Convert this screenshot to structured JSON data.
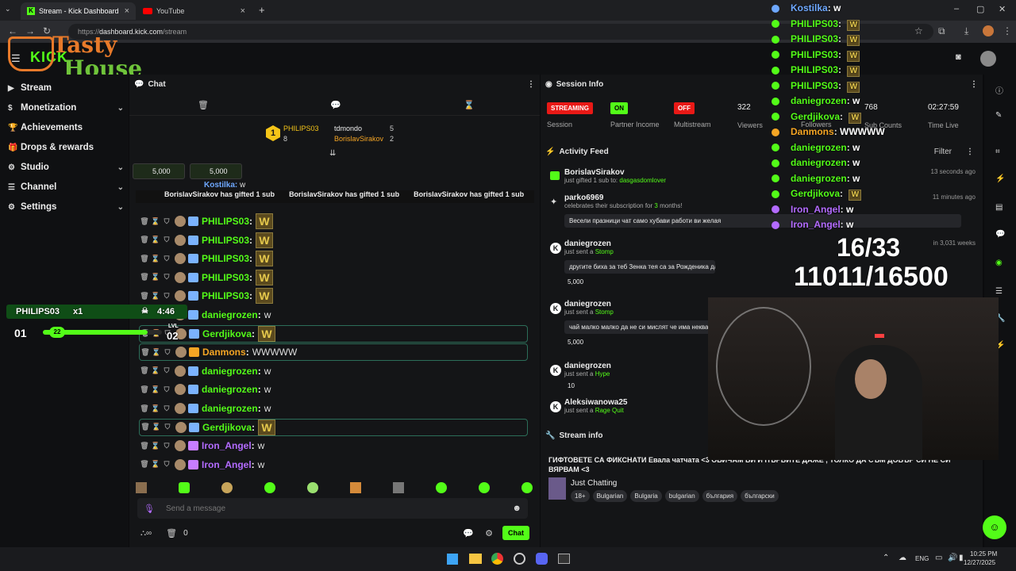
{
  "browser": {
    "tabs": [
      {
        "label": "Stream - Kick Dashboard"
      },
      {
        "label": "YouTube"
      }
    ],
    "url_prefix": "https://",
    "url_host": "dashboard.kick.com",
    "url_path": "/stream"
  },
  "overlay_logo": {
    "line1": "Tasty",
    "line2": "House"
  },
  "sidebar": {
    "items": [
      {
        "label": "Stream",
        "icon": "video-icon",
        "expandable": false
      },
      {
        "label": "Monetization",
        "icon": "dollar-icon",
        "expandable": true
      },
      {
        "label": "Achievements",
        "icon": "trophy-icon",
        "expandable": false
      },
      {
        "label": "Drops & rewards",
        "icon": "gift-icon",
        "expandable": false
      },
      {
        "label": "Studio",
        "icon": "gear-icon",
        "expandable": true
      },
      {
        "label": "Channel",
        "icon": "list-icon",
        "expandable": true
      },
      {
        "label": "Settings",
        "icon": "gear-icon",
        "expandable": true
      }
    ]
  },
  "chat": {
    "title": "Chat",
    "leaderboard": {
      "first": {
        "name": "PHILIPS03",
        "count": "8",
        "rank": "1"
      },
      "second": {
        "name": "tdmondo",
        "count": "5"
      },
      "third": {
        "name": "BorislavSirakov",
        "count": "2"
      }
    },
    "kick_chips": [
      "5,000",
      "5,000"
    ],
    "pinned_ticker": [
      "BorislavSirakov has gifted 1 sub",
      "BorislavSirakov has gifted 1 sub",
      "BorislavSirakov has gifted 1 sub"
    ],
    "top_partial_name": "Kostilka",
    "top_partial_text": "w",
    "messages": [
      {
        "user": "PHILIPS03",
        "color": "#53fc18",
        "text": "",
        "emote": true,
        "highlight": false
      },
      {
        "user": "PHILIPS03",
        "color": "#53fc18",
        "text": "",
        "emote": true,
        "highlight": false
      },
      {
        "user": "PHILIPS03",
        "color": "#53fc18",
        "text": "",
        "emote": true,
        "highlight": false
      },
      {
        "user": "PHILIPS03",
        "color": "#53fc18",
        "text": "",
        "emote": true,
        "highlight": false
      },
      {
        "user": "PHILIPS03",
        "color": "#53fc18",
        "text": "",
        "emote": true,
        "highlight": false
      },
      {
        "user": "daniegrozen",
        "color": "#53fc18",
        "text": "w",
        "emote": false,
        "highlight": false
      },
      {
        "user": "Gerdjikova",
        "color": "#53fc18",
        "text": "",
        "emote": true,
        "highlight": true
      },
      {
        "user": "Danmons",
        "color": "#f5a524",
        "text": "WWWWW",
        "emote": false,
        "highlight": true
      },
      {
        "user": "daniegrozen",
        "color": "#53fc18",
        "text": "w",
        "emote": false,
        "highlight": false
      },
      {
        "user": "daniegrozen",
        "color": "#53fc18",
        "text": "w",
        "emote": false,
        "highlight": false
      },
      {
        "user": "daniegrozen",
        "color": "#53fc18",
        "text": "w",
        "emote": false,
        "highlight": false
      },
      {
        "user": "Gerdjikova",
        "color": "#53fc18",
        "text": "",
        "emote": true,
        "highlight": true
      },
      {
        "user": "Iron_Angel",
        "color": "#b36bff",
        "text": "w",
        "emote": false,
        "highlight": false
      },
      {
        "user": "Iron_Angel",
        "color": "#b36bff",
        "text": "w",
        "emote": false,
        "highlight": false
      }
    ],
    "input_placeholder": "Send a message",
    "footer_count": "0",
    "chat_button": "Chat"
  },
  "overlay_player": {
    "name": "PHILIPS03",
    "multiplier": "x1",
    "timer": "4:46",
    "level_prefix": "LVL",
    "level": "02",
    "slot": "01",
    "progress_label": "22"
  },
  "overlay_chat": {
    "lines": [
      {
        "user": "Kostilka",
        "text": "w",
        "color": "#6ea8ff",
        "emote": false
      },
      {
        "user": "PHILIPS03",
        "text": "",
        "color": "#53fc18",
        "emote": true
      },
      {
        "user": "PHILIPS03",
        "text": "",
        "color": "#53fc18",
        "emote": true
      },
      {
        "user": "PHILIPS03",
        "text": "",
        "color": "#53fc18",
        "emote": true
      },
      {
        "user": "PHILIPS03",
        "text": "",
        "color": "#53fc18",
        "emote": true
      },
      {
        "user": "PHILIPS03",
        "text": "",
        "color": "#53fc18",
        "emote": true
      },
      {
        "user": "daniegrozen",
        "text": "w",
        "color": "#53fc18",
        "emote": false
      },
      {
        "user": "Gerdjikova",
        "text": "",
        "color": "#53fc18",
        "emote": true
      },
      {
        "user": "Danmons",
        "text": "WWWWW",
        "color": "#f5a524",
        "emote": false
      },
      {
        "user": "daniegrozen",
        "text": "w",
        "color": "#53fc18",
        "emote": false
      },
      {
        "user": "daniegrozen",
        "text": "w",
        "color": "#53fc18",
        "emote": false
      },
      {
        "user": "daniegrozen",
        "text": "w",
        "color": "#53fc18",
        "emote": false
      },
      {
        "user": "Gerdjikova",
        "text": "",
        "color": "#53fc18",
        "emote": true
      },
      {
        "user": "Iron_Angel",
        "text": "w",
        "color": "#b36bff",
        "emote": false
      },
      {
        "user": "Iron_Angel",
        "text": "w",
        "color": "#b36bff",
        "emote": false
      }
    ],
    "counter1": "16/33",
    "counter2": "11011/16500"
  },
  "session": {
    "title": "Session Info",
    "streaming": "STREAMING",
    "session_label": "Session",
    "partner_on": "ON",
    "partner_label": "Partner Income",
    "multistream_off": "OFF",
    "multistream_label": "Multistream",
    "viewers": "322",
    "viewers_label": "Viewers",
    "followers_label": "Followers",
    "subs": "768",
    "subs_label": "Sub Counts",
    "time": "02:27:59",
    "time_label": "Time Live"
  },
  "activity": {
    "title": "Activity Feed",
    "filter": "Filter",
    "items": [
      {
        "name": "BorislavSirakov",
        "sub": "just gifted 1 sub to:",
        "highlight": "dasgasdomlover",
        "time": "13 seconds ago",
        "message": "",
        "amount": ""
      },
      {
        "name": "parko6969",
        "sub": "celebrates their subscription for",
        "highlight": "3",
        "suffix": "months!",
        "time": "11 minutes ago",
        "message": "Весели празници чат само хубави работи ви желая",
        "amount": ""
      },
      {
        "name": "daniegrozen",
        "sub": "just sent a",
        "highlight": "Stomp",
        "time": "in 3,031 weeks",
        "message": "другите биха за теб Зенка тея са за Рожденика да има си харчи чрд наркомабтотоо",
        "amount": "5,000"
      },
      {
        "name": "daniegrozen",
        "sub": "just sent a",
        "highlight": "Stomp",
        "time": "",
        "message": "чай малко малко да не си мислят че има неква",
        "amount": "5,000"
      },
      {
        "name": "daniegrozen",
        "sub": "just sent a",
        "highlight": "Hype",
        "time": "",
        "message": "",
        "amount": "10"
      },
      {
        "name": "Aleksiwanowa25",
        "sub": "just sent a",
        "highlight": "Rage Quit",
        "time": "",
        "message": "",
        "amount": ""
      }
    ]
  },
  "stream_info": {
    "title": "Stream info",
    "stream_title": "ГИФТОВЕТЕ СА ФИКСНАТИ Евала чатчата <3 ОБИЧАМ ВИ И ПЪРВИТЕ ДАЖЕ , ТОЛКО ДА СЪМ ДОБЪР СИ НЕ СИ ВЯРВАМ <3",
    "category": "Just Chatting",
    "tags": [
      "18+",
      "Bulgarian",
      "Bulgaria",
      "bulgarian",
      "българия",
      "български"
    ]
  },
  "taskbar": {
    "lang": "ENG",
    "time": "10:25 PM",
    "date": "12/27/2025"
  },
  "colors": {
    "accent": "#53fc18",
    "streaming": "#e91916",
    "off": "#e91916",
    "on": "#53fc18"
  }
}
